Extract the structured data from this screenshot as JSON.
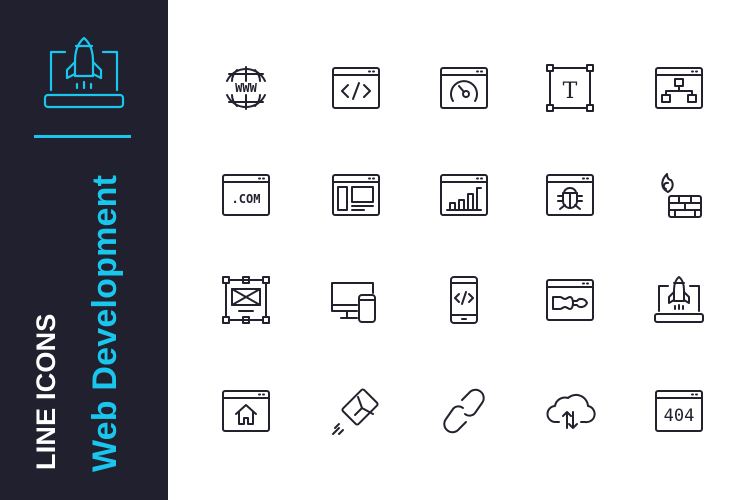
{
  "sidebar": {
    "subtitle": "LINE ICONS",
    "title": "Web Development",
    "hero_icon": "laptop-rocket-icon",
    "accent_color": "#18c6ee",
    "background_color": "#21202e"
  },
  "icon_grid": {
    "stroke_color": "#22212d",
    "rows": [
      [
        "www-globe-icon",
        "browser-code-icon",
        "browser-speedometer-icon",
        "text-tool-icon",
        "browser-sitemap-icon"
      ],
      [
        "browser-dotcom-icon",
        "browser-layout-icon",
        "browser-bar-chart-icon",
        "browser-bug-icon",
        "firewall-icon"
      ],
      [
        "wireframe-icon",
        "responsive-devices-icon",
        "mobile-code-icon",
        "browser-screwdriver-icon",
        "laptop-rocket-icon"
      ],
      [
        "browser-home-icon",
        "send-mail-icon",
        "link-icon",
        "cloud-transfer-icon",
        "browser-404-icon"
      ]
    ],
    "labels": {
      "www": "WWW",
      "dotcom": ".COM",
      "text_tool": "T",
      "error_code": "404"
    }
  }
}
